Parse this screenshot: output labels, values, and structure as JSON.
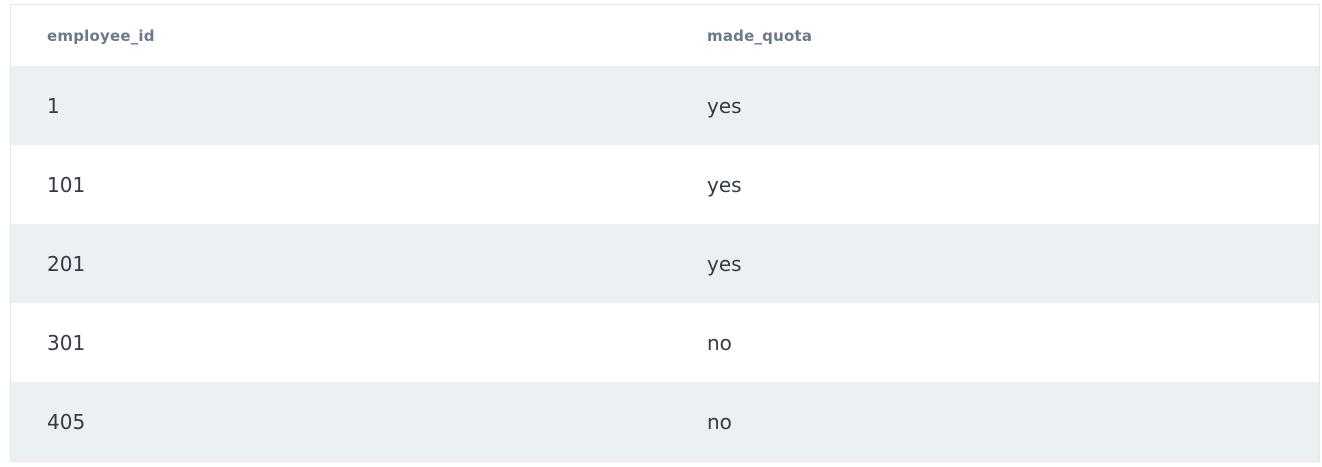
{
  "table": {
    "columns": [
      "employee_id",
      "made_quota"
    ],
    "rows": [
      [
        "1",
        "yes"
      ],
      [
        "101",
        "yes"
      ],
      [
        "201",
        "yes"
      ],
      [
        "301",
        "no"
      ],
      [
        "405",
        "no"
      ]
    ]
  }
}
